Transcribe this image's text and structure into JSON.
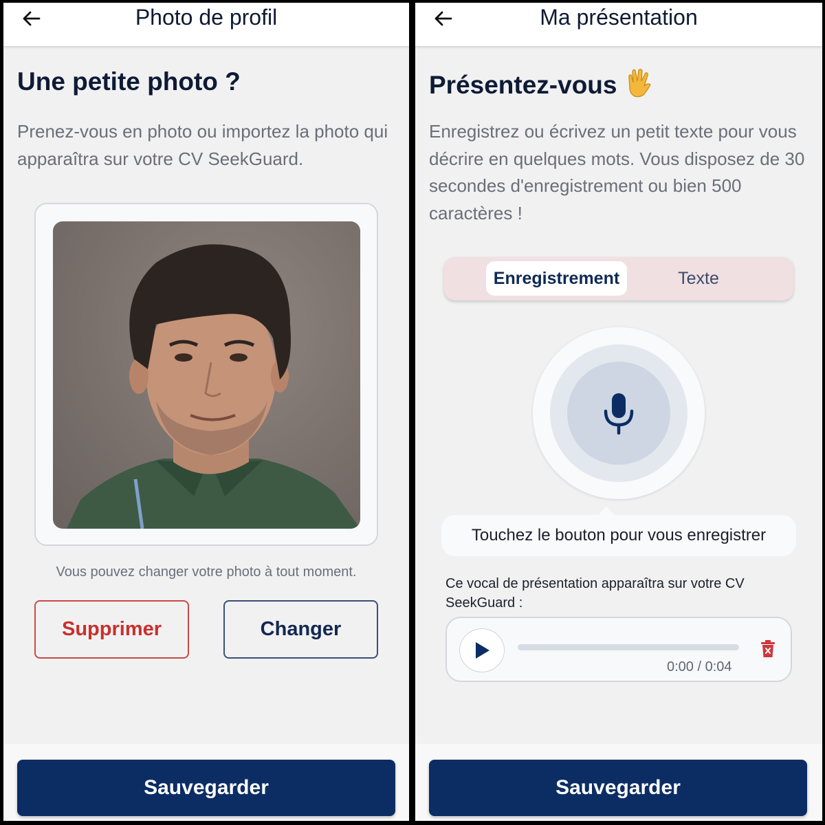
{
  "left_screen": {
    "appbar": {
      "title": "Photo de profil",
      "back_icon": "arrow-left-icon"
    },
    "heading": "Une petite photo ?",
    "description": "Prenez-vous en photo ou importez la photo qui apparaîtra sur votre CV SeekGuard.",
    "hint": "Vous pouvez changer votre photo à tout moment.",
    "delete_label": "Supprimer",
    "change_label": "Changer",
    "save_label": "Sauvegarder"
  },
  "right_screen": {
    "appbar": {
      "title": "Ma présentation",
      "back_icon": "arrow-left-icon"
    },
    "heading": "Présentez-vous",
    "heading_emoji": "vulcan-salute-hand-icon",
    "description": "Enregistrez ou écrivez un petit texte pour vous décrire en quelques mots. Vous disposez de 30 secondes d'enregistrement ou bien 500 caractères !",
    "tabs": [
      {
        "label": "Enregistrement",
        "active": true
      },
      {
        "label": "Texte",
        "active": false
      }
    ],
    "record_hint": "Touchez le bouton pour vous enregistrer",
    "vocal_label": "Ce vocal de présentation apparaîtra sur votre CV SeekGuard :",
    "player": {
      "time": "0:00 / 0:04",
      "progress": 0
    },
    "save_label": "Sauvegarder"
  },
  "colors": {
    "primary": "#0c2d64",
    "danger": "#c9302c",
    "segment_bg": "#f1e0e1",
    "text_dark": "#0e1b35",
    "text_muted": "#6a6e78"
  }
}
